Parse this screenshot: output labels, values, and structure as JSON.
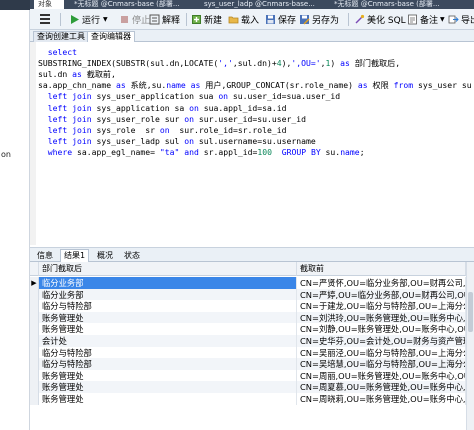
{
  "left_strip": {
    "labels": [
      "on"
    ]
  },
  "window_tabs": [
    {
      "label": "对象",
      "active": true
    },
    {
      "label": "*无标题 @Cnmars-base (部署...",
      "active": false
    },
    {
      "label": "sys_user_ladp @Cnmars-base...",
      "active": false
    },
    {
      "label": "*无标题 @Cnmars-base (部署...",
      "active": false
    }
  ],
  "toolbar": {
    "run": "运行",
    "stop": "停止",
    "explain": "解释",
    "new": "新建",
    "load": "载入",
    "save": "保存",
    "save_as": "另存为",
    "beautify": "美化 SQL",
    "code_snippet": "备注",
    "export": "导出"
  },
  "editor_tabs": [
    {
      "label": "查询创建工具",
      "active": false
    },
    {
      "label": "查询编辑器",
      "active": true
    }
  ],
  "sql_lines": [
    [
      {
        "t": "  "
      },
      {
        "t": "select",
        "c": "kw"
      }
    ],
    [
      {
        "t": "SUBSTRING_INDEX(SUBSTR(sul.dn,LOCATE("
      },
      {
        "t": "','",
        "c": "str"
      },
      {
        "t": ",sul.dn)+"
      },
      {
        "t": "4",
        "c": "num"
      },
      {
        "t": "),"
      },
      {
        "t": "',OU='",
        "c": "str"
      },
      {
        "t": ","
      },
      {
        "t": "1",
        "c": "num"
      },
      {
        "t": ") "
      },
      {
        "t": "as",
        "c": "kw"
      },
      {
        "t": " 部门截取后,"
      }
    ],
    [
      {
        "t": "sul.dn "
      },
      {
        "t": "as",
        "c": "kw"
      },
      {
        "t": " 截取前,"
      }
    ],
    [
      {
        "t": "sa.app_chn_name "
      },
      {
        "t": "as",
        "c": "kw"
      },
      {
        "t": " 系统,su."
      },
      {
        "t": "name",
        "c": "kw"
      },
      {
        "t": " "
      },
      {
        "t": "as",
        "c": "kw"
      },
      {
        "t": " 用户,GROUP_CONCAT(sr.role_name) "
      },
      {
        "t": "as",
        "c": "kw"
      },
      {
        "t": " 权限 "
      },
      {
        "t": "from",
        "c": "kw"
      },
      {
        "t": " sys_user su"
      }
    ],
    [
      {
        "t": "  "
      },
      {
        "t": "left join",
        "c": "kw"
      },
      {
        "t": " sys_user_application sua "
      },
      {
        "t": "on",
        "c": "kw"
      },
      {
        "t": " su.user_id=sua.user_id"
      }
    ],
    [
      {
        "t": "  "
      },
      {
        "t": "left join",
        "c": "kw"
      },
      {
        "t": " sys_application sa "
      },
      {
        "t": "on",
        "c": "kw"
      },
      {
        "t": " sua.appl_id=sa.id"
      }
    ],
    [
      {
        "t": "  "
      },
      {
        "t": "left join",
        "c": "kw"
      },
      {
        "t": " sys_user_role sur "
      },
      {
        "t": "on",
        "c": "kw"
      },
      {
        "t": " sur.user_id=su.user_id"
      }
    ],
    [
      {
        "t": "  "
      },
      {
        "t": "left join",
        "c": "kw"
      },
      {
        "t": " sys_role  sr "
      },
      {
        "t": "on",
        "c": "kw"
      },
      {
        "t": "  sur.role_id=sr.role_id"
      }
    ],
    [
      {
        "t": "  "
      },
      {
        "t": "left join",
        "c": "kw"
      },
      {
        "t": " sys_user_ladp sul "
      },
      {
        "t": "on",
        "c": "kw"
      },
      {
        "t": " sul.username=su.username"
      }
    ],
    [
      {
        "t": "  "
      },
      {
        "t": "where",
        "c": "kw"
      },
      {
        "t": " sa.app_egl_name= "
      },
      {
        "t": "\"ta\"",
        "c": "str"
      },
      {
        "t": " "
      },
      {
        "t": "and",
        "c": "kw"
      },
      {
        "t": " sr.appl_id="
      },
      {
        "t": "100",
        "c": "num"
      },
      {
        "t": "  "
      },
      {
        "t": "GROUP BY",
        "c": "kw"
      },
      {
        "t": " su."
      },
      {
        "t": "name",
        "c": "kw"
      },
      {
        "t": ";"
      }
    ]
  ],
  "result_tabs": [
    {
      "label": "信息",
      "active": false
    },
    {
      "label": "结果1",
      "active": true
    },
    {
      "label": "概况",
      "active": false
    },
    {
      "label": "状态",
      "active": false
    }
  ],
  "grid": {
    "columns": [
      "部门截取后",
      "截取前"
    ],
    "rows": [
      [
        "临分业务部",
        "CN=严贤怀,OU=临分业务部,OU=财再公司,OU=中国"
      ],
      [
        "临分业务部",
        "CN=严婷,OU=临分业务部,OU=财再公司,OU=中国"
      ],
      [
        "临分与特险部",
        "CN=于建龙,OU=临分与特险部,OU=上海分公司,OU=中"
      ],
      [
        "账务管理处",
        "CN=刘洪玲,OU=账务管理处,OU=账务中心,OU=财"
      ],
      [
        "账务管理处",
        "CN=刘静,OU=账务管理处,OU=账务中心,OU=财再"
      ],
      [
        "会计处",
        "CN=史华芬,OU=会计处,OU=财务与资产管理部,O"
      ],
      [
        "临分与特险部",
        "CN=吴丽泾,OU=临分与特险部,OU=上海分公司,OU=中"
      ],
      [
        "临分与特险部",
        "CN=吴培慧,OU=临分与特险部,OU=上海分公司,OU=中"
      ],
      [
        "账务管理处",
        "CN=周丽,OU=账务管理处,OU=账务中心,OU=财再"
      ],
      [
        "账务管理处",
        "CN=周夏慕,OU=账务管理处,OU=账务中心,OU=财"
      ],
      [
        "账务管理处",
        "CN=周晓莉,OU=账务管理处,OU=账务中心,OU=财"
      ]
    ],
    "selected_row": 0
  },
  "colors": {
    "keyword": "#0000ff",
    "number": "#098658",
    "selection": "#3a86e8",
    "run_icon": "#2e9c3a",
    "stop_icon": "#c0392b"
  }
}
